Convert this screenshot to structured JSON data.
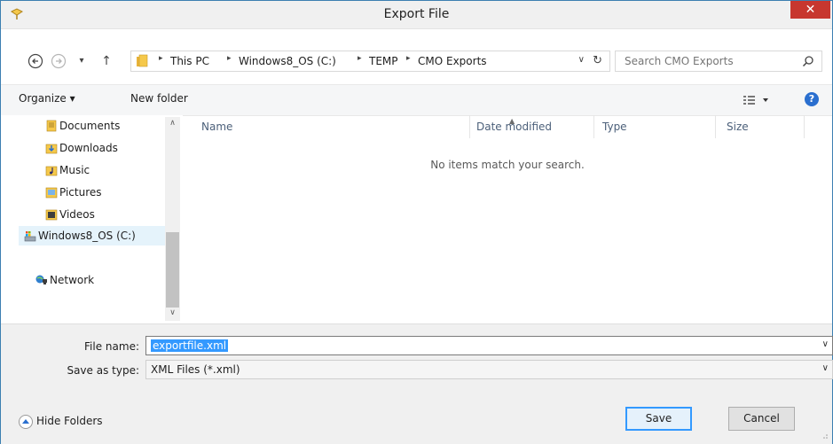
{
  "window": {
    "title": "Export File",
    "close_glyph": "✕"
  },
  "nav": {
    "back_glyph": "⊖",
    "forward_glyph": "⊖",
    "recent_glyph": "▾",
    "up_glyph": "↑",
    "breadcrumbs": [
      "This PC",
      "Windows8_OS (C:)",
      "TEMP",
      "CMO Exports"
    ],
    "crumb_sep": "▸",
    "address_dropdown_glyph": "∨",
    "refresh_glyph": "↻",
    "search_placeholder": "Search CMO Exports"
  },
  "toolbar": {
    "organize_label": "Organize ▾",
    "new_folder_label": "New folder",
    "help_glyph": "?"
  },
  "sidebar": {
    "items": [
      {
        "label": "Documents",
        "icon": "documents-icon"
      },
      {
        "label": "Downloads",
        "icon": "downloads-icon"
      },
      {
        "label": "Music",
        "icon": "music-icon"
      },
      {
        "label": "Pictures",
        "icon": "pictures-icon"
      },
      {
        "label": "Videos",
        "icon": "videos-icon"
      },
      {
        "label": "Windows8_OS (C:)",
        "icon": "drive-icon",
        "selected": true
      },
      {
        "label": "Network",
        "icon": "network-icon"
      }
    ],
    "scroll_up_glyph": "∧",
    "scroll_down_glyph": "∨"
  },
  "file_list": {
    "columns": [
      "Name",
      "Date modified",
      "Type",
      "Size"
    ],
    "empty_message": "No items match your search."
  },
  "form": {
    "file_name_label": "File name:",
    "file_name_value": "exportfile.xml",
    "save_type_label": "Save as type:",
    "save_type_value": "XML Files (*.xml)",
    "dropdown_glyph": "∨"
  },
  "footer": {
    "hide_folders_label": "Hide Folders",
    "save_label": "Save",
    "cancel_label": "Cancel"
  },
  "colors": {
    "accent": "#3399ff",
    "close": "#c7372f",
    "selection": "#e5f3fb"
  }
}
